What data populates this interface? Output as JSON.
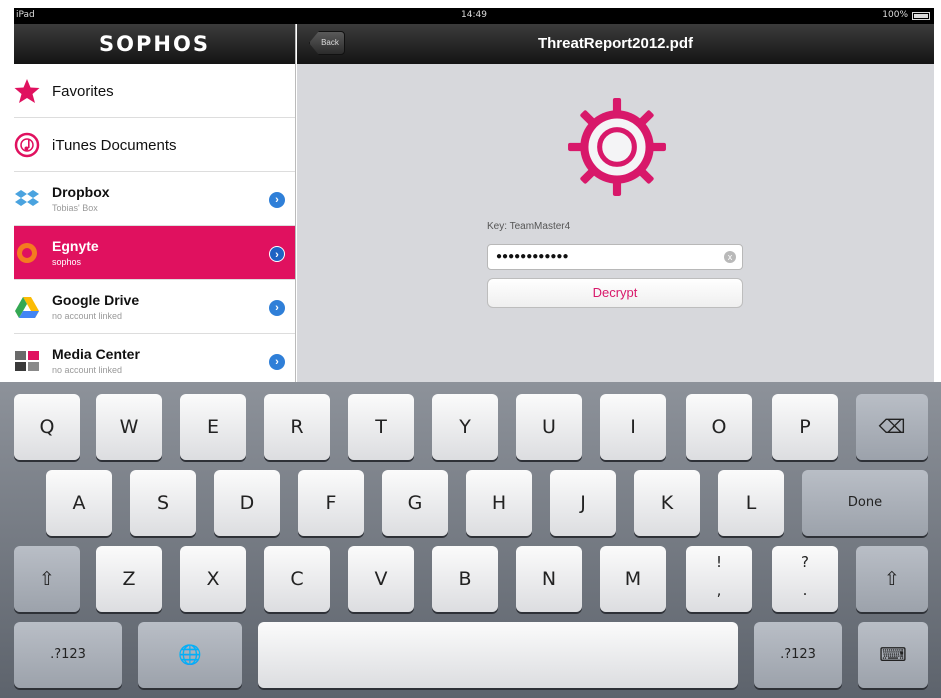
{
  "status_bar": {
    "carrier": "iPad",
    "time": "14:49",
    "battery": "100%"
  },
  "sidebar": {
    "title": "SOPHOS",
    "items": [
      {
        "title": "Favorites",
        "subtitle": "",
        "icon": "star-icon"
      },
      {
        "title": "iTunes Documents",
        "subtitle": "",
        "icon": "itunes-icon"
      },
      {
        "title": "Dropbox",
        "subtitle": "Tobias' Box",
        "icon": "dropbox-icon"
      },
      {
        "title": "Egnyte",
        "subtitle": "sophos",
        "icon": "egnyte-icon",
        "selected": true
      },
      {
        "title": "Google Drive",
        "subtitle": "no account linked",
        "icon": "google-drive-icon"
      },
      {
        "title": "Media Center",
        "subtitle": "no account linked",
        "icon": "media-center-icon"
      }
    ]
  },
  "navbar": {
    "back_label": "Back",
    "title": "ThreatReport2012.pdf"
  },
  "detail": {
    "field_label": "Key: TeamMaster4",
    "password_value": "●●●●●●●●●●●●",
    "clear_symbol": "x",
    "decrypt_label": "Decrypt"
  },
  "keyboard": {
    "row1": [
      "Q",
      "W",
      "E",
      "R",
      "T",
      "Y",
      "U",
      "I",
      "O",
      "P"
    ],
    "backspace": "⌫",
    "row2": [
      "A",
      "S",
      "D",
      "F",
      "G",
      "H",
      "J",
      "K",
      "L"
    ],
    "done": "Done",
    "shift": "⇧",
    "row3": [
      "Z",
      "X",
      "C",
      "V",
      "B",
      "N",
      "M"
    ],
    "punct1_top": "!",
    "punct1_bottom": ",",
    "punct2_top": "?",
    "punct2_bottom": ".",
    "numbers": ".?123",
    "globe": "🌐",
    "hide_keyboard": "⌨"
  },
  "colors": {
    "accent": "#e0115f",
    "disclosure": "#2f7fd8",
    "detail_bg": "#d7d8dc"
  }
}
